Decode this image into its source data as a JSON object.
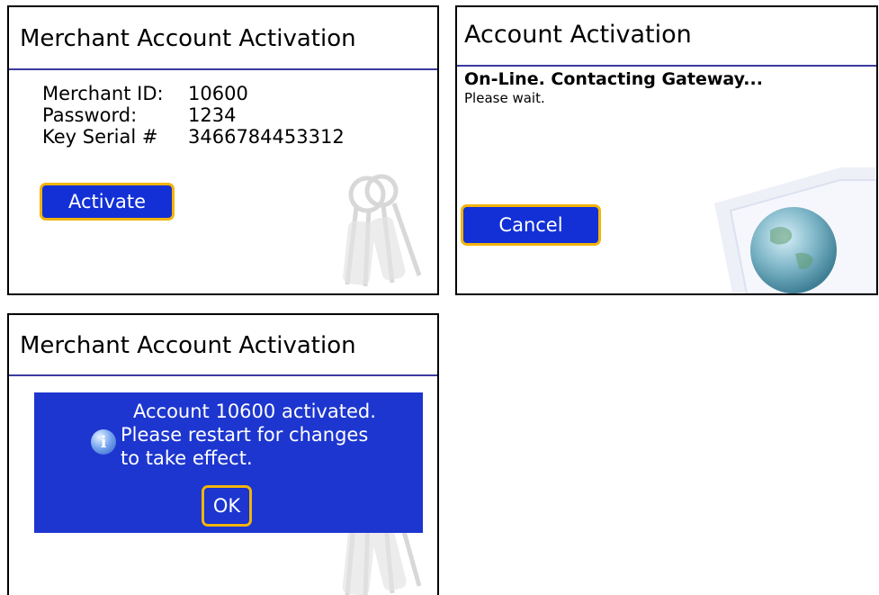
{
  "screen1": {
    "title": "Merchant Account Activation",
    "fields": [
      {
        "label": "Merchant ID:",
        "value": "10600"
      },
      {
        "label": "Password:",
        "value": "1234"
      },
      {
        "label": "Key Serial #",
        "value": "3466784453312"
      }
    ],
    "activate_label": "Activate"
  },
  "screen2": {
    "title": "Account Activation",
    "status": "On-Line. Contacting Gateway...",
    "substatus": "Please wait.",
    "cancel_label": "Cancel"
  },
  "screen3": {
    "title": "Merchant Account Activation",
    "dialog": {
      "line1": "Account 10600 activated.",
      "line2": "Please restart for changes",
      "line3": "to take effect.",
      "ok_label": "OK",
      "icon": "info-icon"
    }
  },
  "colors": {
    "button_bg": "#1230d6",
    "button_border": "#f2b40c",
    "dialog_bg": "#1d36d0",
    "title_rule": "#3a3a9e"
  }
}
